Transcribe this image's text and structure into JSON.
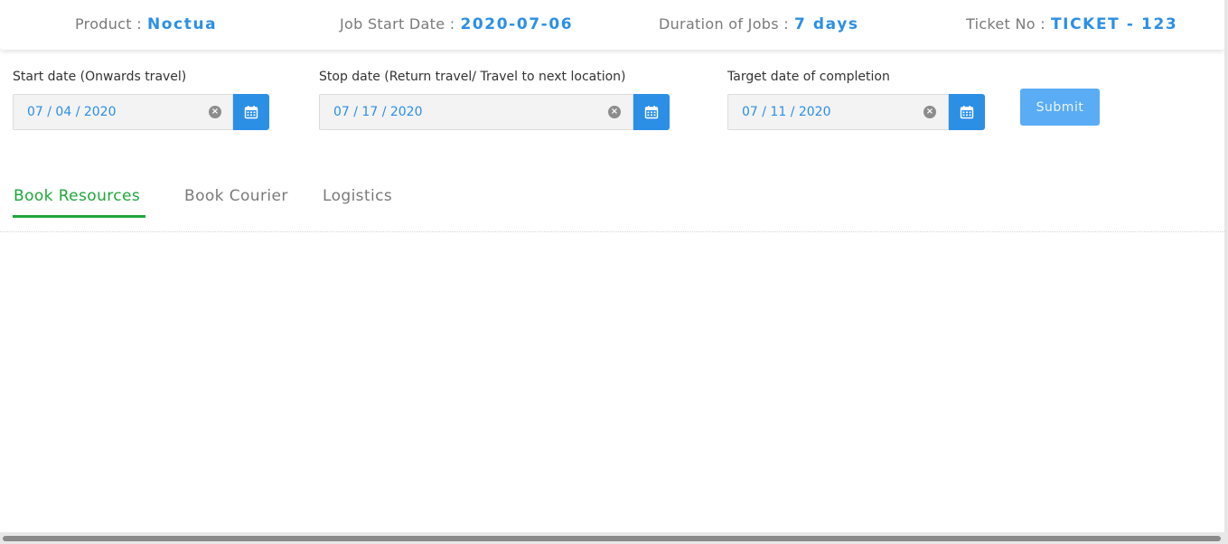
{
  "header": {
    "product_label": "Product :",
    "product_value": "Noctua",
    "job_start_label": "Job Start Date :",
    "job_start_value": "2020-07-06",
    "duration_label": "Duration of Jobs :",
    "duration_value": "7 days",
    "ticket_label": "Ticket No :",
    "ticket_value": "TICKET - 123"
  },
  "form": {
    "start": {
      "label": "Start date (Onwards travel)",
      "value": "07 / 04 / 2020"
    },
    "stop": {
      "label": "Stop date (Return travel/ Travel to next location)",
      "value": "07 / 17 / 2020"
    },
    "target": {
      "label": "Target date of completion",
      "value": "07 / 11 / 2020"
    },
    "submit_label": "Submit"
  },
  "tabs": [
    {
      "label": "Book Resources",
      "active": true
    },
    {
      "label": "Book Courier",
      "active": false
    },
    {
      "label": "Logistics",
      "active": false
    }
  ],
  "icons": {
    "clear": "clear-icon",
    "calendar": "calendar-icon"
  },
  "colors": {
    "accent": "#2b8fe6",
    "active_tab": "#1fa73a",
    "submit": "#5aacf5"
  }
}
